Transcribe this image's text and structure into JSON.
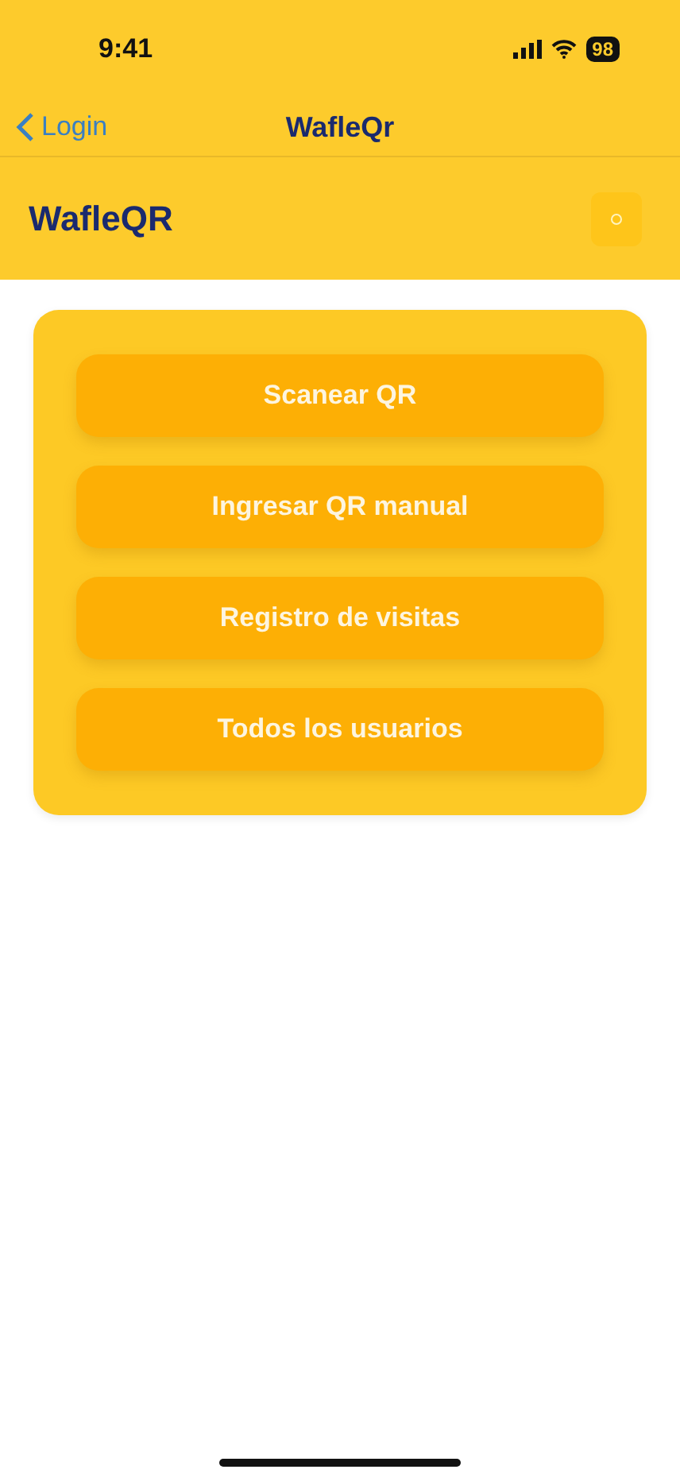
{
  "status_bar": {
    "time": "9:41",
    "battery": "98"
  },
  "nav_bar": {
    "back": "Login",
    "title": "WafleQr"
  },
  "header": {
    "title": "WafleQR"
  },
  "menu": [
    {
      "label": "Scanear QR"
    },
    {
      "label": "Ingresar QR manual"
    },
    {
      "label": "Registro de visitas"
    },
    {
      "label": "Todos los usuarios"
    }
  ]
}
